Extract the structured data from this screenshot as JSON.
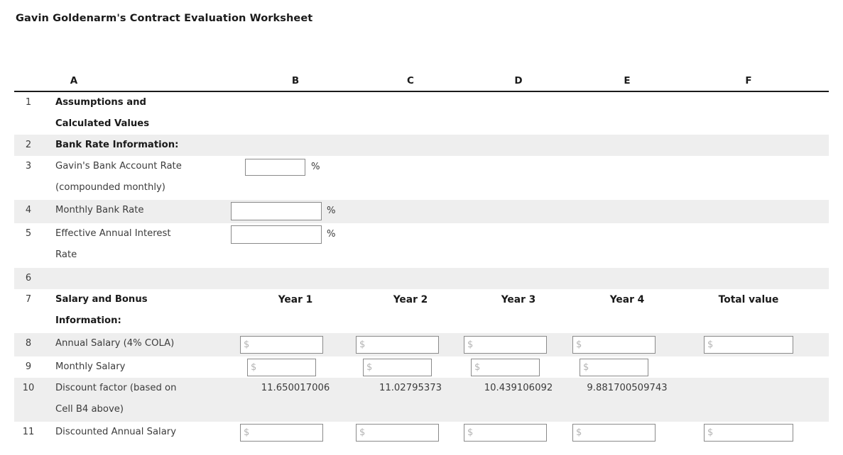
{
  "title": "Gavin Goldenarm's Contract Evaluation Worksheet",
  "columns": [
    "A",
    "B",
    "C",
    "D",
    "E",
    "F"
  ],
  "percent_symbol": "%",
  "currency_placeholder": "$",
  "rows": {
    "r1": {
      "num": "1",
      "label_line1": "Assumptions and",
      "label_line2": "Calculated Values"
    },
    "r2": {
      "num": "2",
      "label": "Bank Rate Information:"
    },
    "r3": {
      "num": "3",
      "label_line1": "Gavin's Bank Account Rate",
      "label_line2": "(compounded monthly)",
      "value": ""
    },
    "r4": {
      "num": "4",
      "label": "Monthly Bank Rate",
      "value": ""
    },
    "r5": {
      "num": "5",
      "label_line1": "Effective Annual Interest",
      "label_line2": "Rate",
      "value": ""
    },
    "r6": {
      "num": "6",
      "label": ""
    },
    "r7": {
      "num": "7",
      "label_line1": "Salary and Bonus",
      "label_line2": "Information:",
      "headers": [
        "Year 1",
        "Year 2",
        "Year 3",
        "Year 4",
        "Total value"
      ]
    },
    "r8": {
      "num": "8",
      "label": "Annual Salary (4% COLA)",
      "values": [
        "",
        "",
        "",
        "",
        ""
      ]
    },
    "r9": {
      "num": "9",
      "label": "Monthly Salary",
      "values": [
        "",
        "",
        "",
        ""
      ]
    },
    "r10": {
      "num": "10",
      "label_line1": "Discount factor (based on",
      "label_line2": "Cell B4 above)",
      "values": [
        "11.650017006",
        "11.02795373",
        "10.439106092",
        "9.881700509743"
      ]
    },
    "r11": {
      "num": "11",
      "label": "Discounted Annual Salary",
      "values": [
        "",
        "",
        "",
        "",
        ""
      ]
    }
  }
}
